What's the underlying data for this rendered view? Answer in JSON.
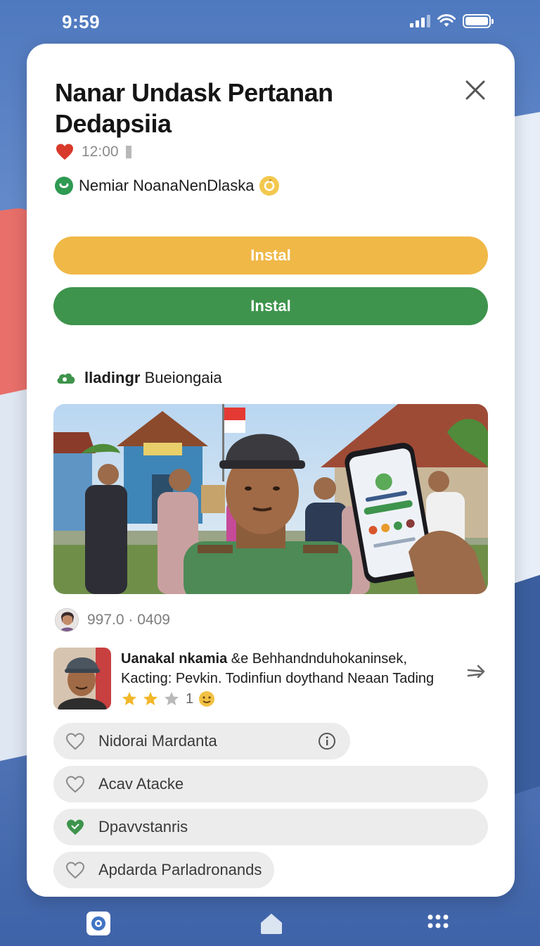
{
  "status_bar": {
    "time": "9:59"
  },
  "app": {
    "title": "Nanar Undask Pertanan Dedapsiia",
    "meta_time": "12:00",
    "developer": "Nemiar NoanaNenDlaska"
  },
  "buttons": {
    "primary_label": "Instal",
    "secondary_label": "Instal"
  },
  "section": {
    "title_bold": "lladingr",
    "title_rest": " Bueiongaia"
  },
  "review": {
    "date": "997.0 · 0409",
    "author": "Uanakal nkamia",
    "text": " &e Behhandnduhokaninsek, Kacting: Pevkin. Todinfiun doythand Neaan Tading",
    "rating": "1",
    "stars_filled": 2,
    "stars_total": 3
  },
  "options": [
    {
      "label": "Nidorai Mardanta",
      "icon": "heart-outline-icon"
    },
    {
      "label": "Acav Atacke",
      "icon": "heart-outline-icon"
    },
    {
      "label": "Dpavvstanris",
      "icon": "heart-filled-icon"
    },
    {
      "label": "Apdarda Parladronands",
      "icon": "heart-outline-icon"
    }
  ],
  "colors": {
    "accent_orange": "#f0b847",
    "accent_green": "#3e944c",
    "background_blue": "#4f79bf"
  },
  "nav": [
    "app-icon",
    "home-icon",
    "more-icon"
  ]
}
